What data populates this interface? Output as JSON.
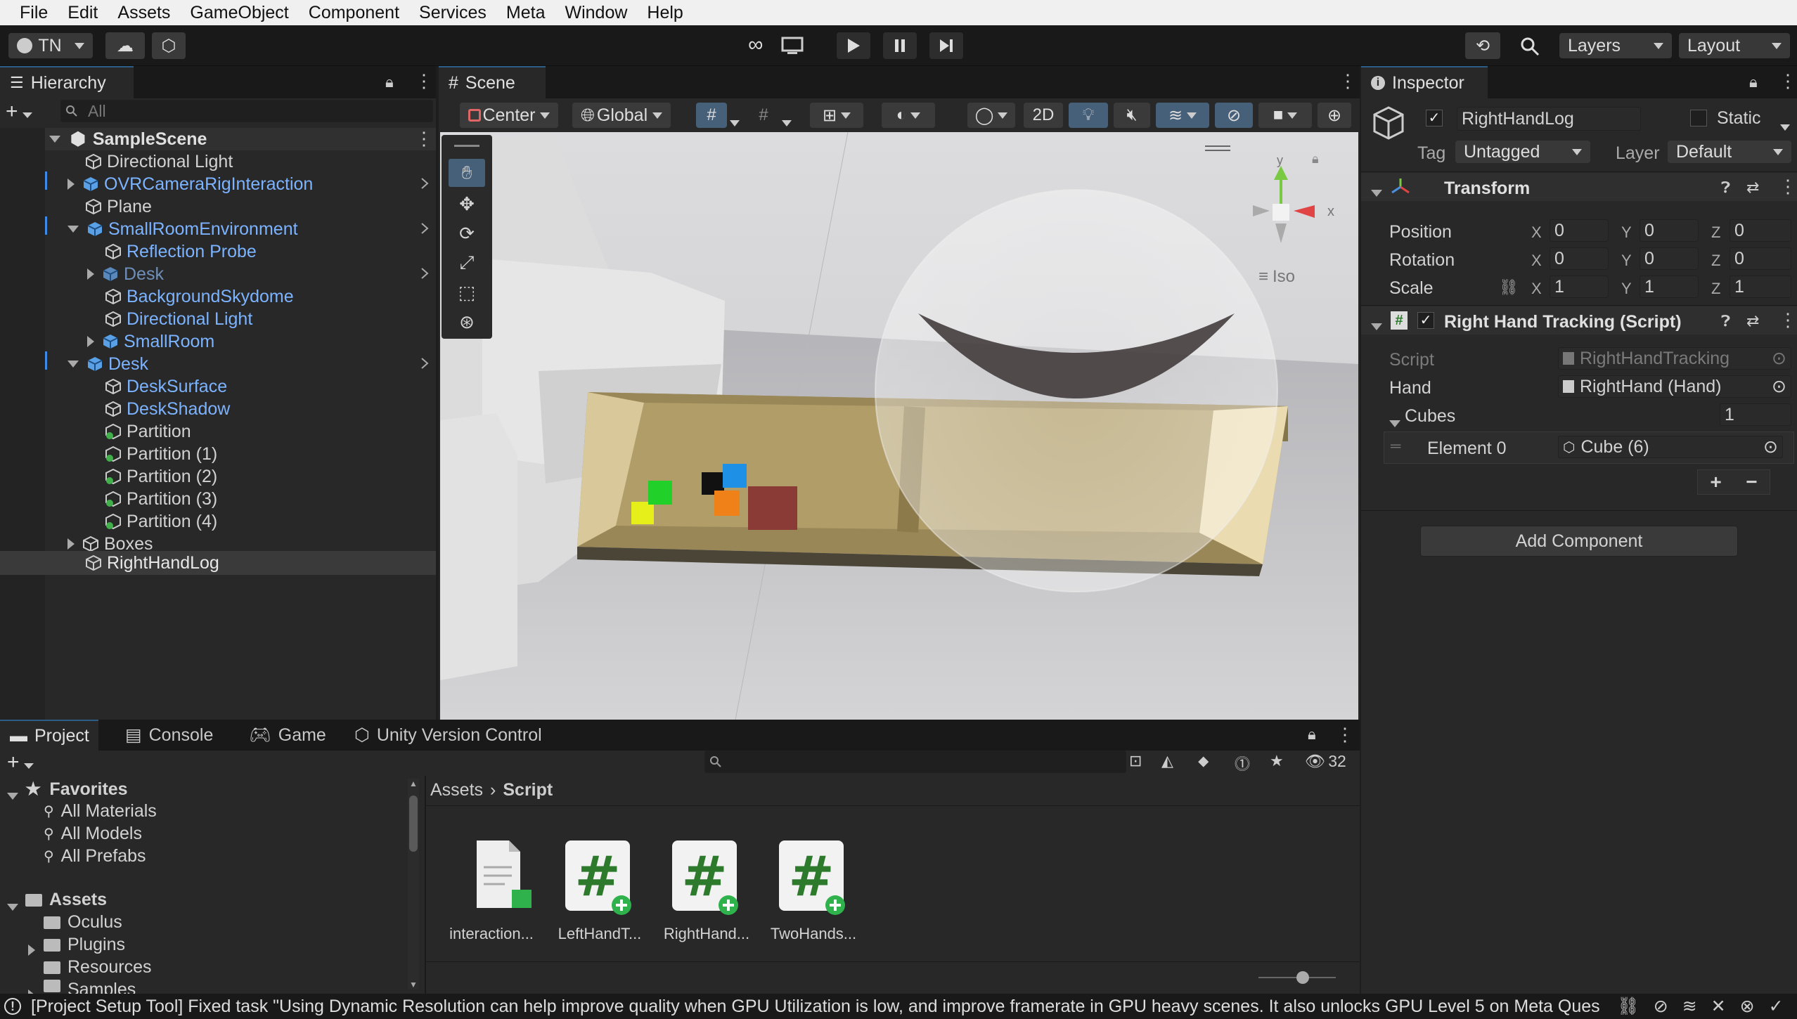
{
  "menu": [
    "File",
    "Edit",
    "Assets",
    "GameObject",
    "Component",
    "Services",
    "Meta",
    "Window",
    "Help"
  ],
  "toolbar": {
    "account": "TN",
    "layers": "Layers",
    "layout": "Layout"
  },
  "hierarchy": {
    "tab": "Hierarchy",
    "search_placeholder": "All",
    "items": [
      {
        "label": "SampleScene"
      },
      {
        "label": "Directional Light"
      },
      {
        "label": "OVRCameraRigInteraction"
      },
      {
        "label": "Plane"
      },
      {
        "label": "SmallRoomEnvironment"
      },
      {
        "label": "Reflection Probe"
      },
      {
        "label": "Desk"
      },
      {
        "label": "BackgroundSkydome"
      },
      {
        "label": "Directional Light"
      },
      {
        "label": "SmallRoom"
      },
      {
        "label": "Desk"
      },
      {
        "label": "DeskSurface"
      },
      {
        "label": "DeskShadow"
      },
      {
        "label": "Partition"
      },
      {
        "label": "Partition (1)"
      },
      {
        "label": "Partition (2)"
      },
      {
        "label": "Partition (3)"
      },
      {
        "label": "Partition (4)"
      },
      {
        "label": "Boxes"
      },
      {
        "label": "RightHandLog"
      }
    ]
  },
  "scene": {
    "tab": "Scene",
    "pivot": "Center",
    "space": "Global",
    "mode_2d": "2D",
    "gizmo_y": "y",
    "gizmo_x": "x",
    "projection": "Iso"
  },
  "inspector": {
    "tab": "Inspector",
    "object_name": "RightHandLog",
    "static_label": "Static",
    "tag_label": "Tag",
    "tag_value": "Untagged",
    "layer_label": "Layer",
    "layer_value": "Default",
    "transform": {
      "title": "Transform",
      "position": {
        "label": "Position",
        "x": "0",
        "y": "0",
        "z": "0"
      },
      "rotation": {
        "label": "Rotation",
        "x": "0",
        "y": "0",
        "z": "0"
      },
      "scale": {
        "label": "Scale",
        "x": "1",
        "y": "1",
        "z": "1"
      }
    },
    "axis_x": "X",
    "axis_y": "Y",
    "axis_z": "Z",
    "script_component": {
      "title": "Right Hand Tracking (Script)",
      "script_label": "Script",
      "script_value": "RightHandTracking",
      "hand_label": "Hand",
      "hand_value": "RightHand (Hand)",
      "cubes_label": "Cubes",
      "cubes_count": "1",
      "element_label": "Element 0",
      "element_value": "Cube (6)"
    },
    "add_component": "Add Component"
  },
  "bottom_tabs": [
    "Project",
    "Console",
    "Game",
    "Unity Version Control"
  ],
  "project": {
    "favorites_title": "Favorites",
    "favorites": [
      "All Materials",
      "All Models",
      "All Prefabs"
    ],
    "assets_title": "Assets",
    "assets": [
      "Oculus",
      "Plugins",
      "Resources",
      "Samples"
    ],
    "breadcrumb_root": "Assets",
    "breadcrumb_current": "Script",
    "hidden_count": "32",
    "files": [
      {
        "name": "interaction...",
        "kind": "doc"
      },
      {
        "name": "LeftHandT...",
        "kind": "cs"
      },
      {
        "name": "RightHand...",
        "kind": "cs"
      },
      {
        "name": "TwoHands...",
        "kind": "cs"
      }
    ]
  },
  "status": {
    "message": "[Project Setup Tool] Fixed task \"Using Dynamic Resolution can help improve quality when GPU Utilization is low, and improve framerate in GPU heavy scenes. It also unlocks GPU Level 5 on Meta Ques"
  }
}
